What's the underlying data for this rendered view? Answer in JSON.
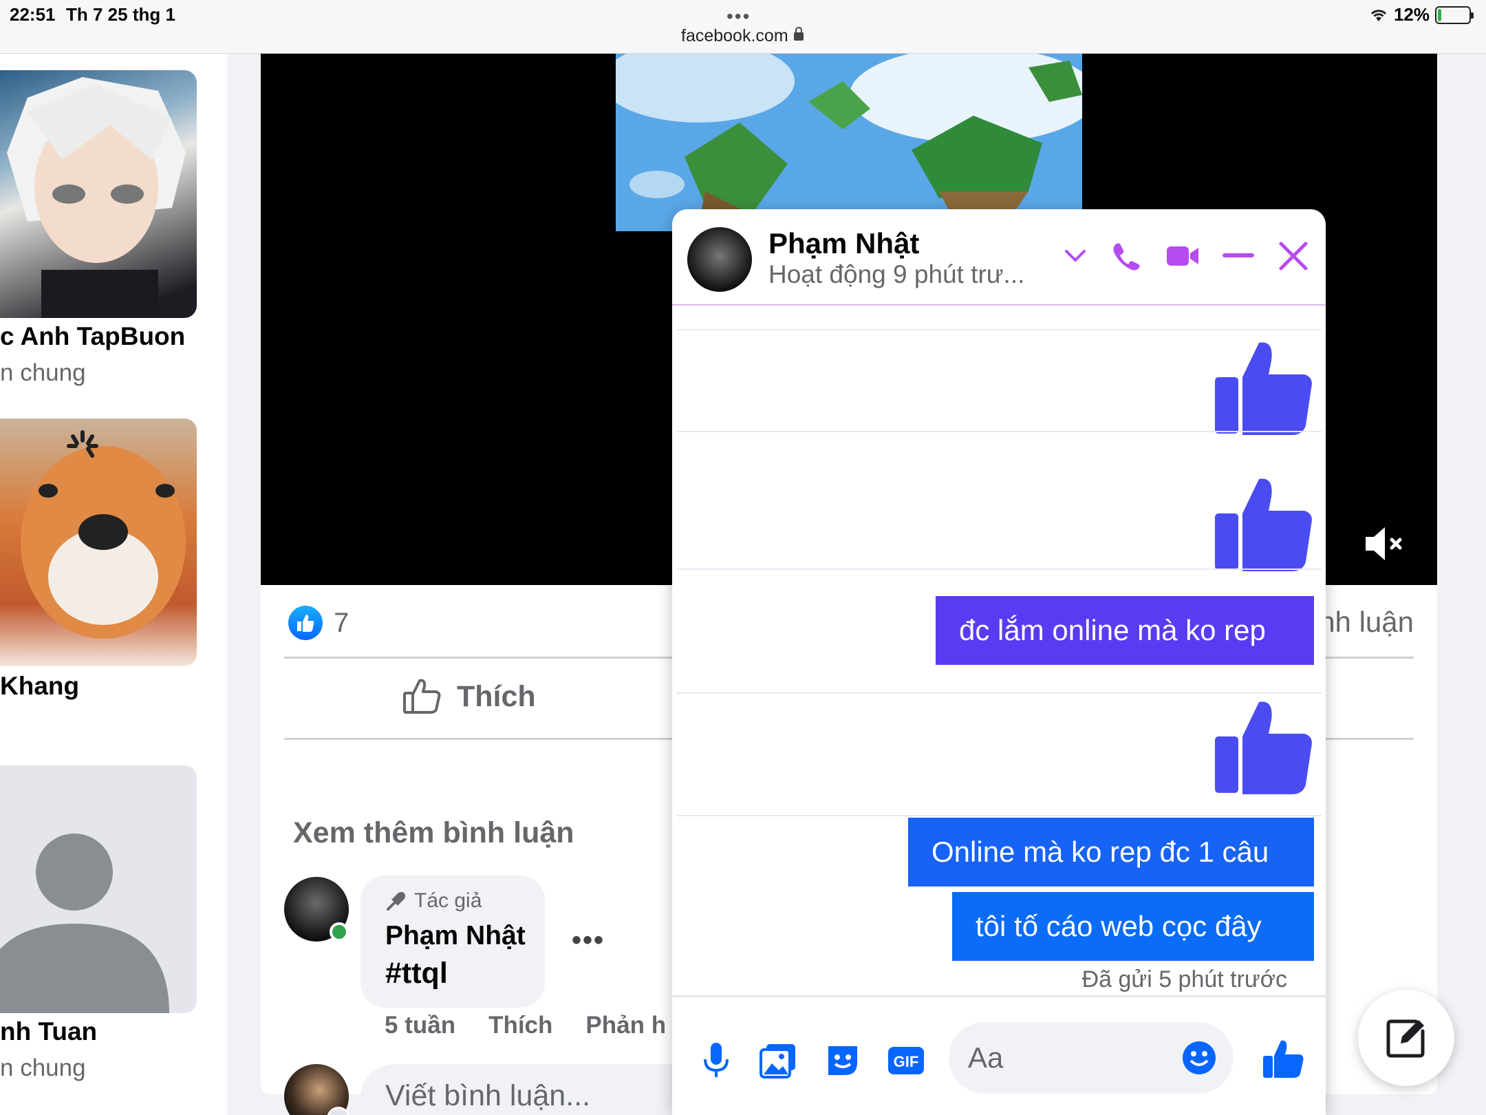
{
  "status_bar": {
    "time": "22:51",
    "date": "Th 7 25 thg 1",
    "url": "facebook.com",
    "battery": "12%",
    "battery_level": 0.12
  },
  "people": [
    {
      "name": "c Anh TapBuon",
      "sub": "n chung"
    },
    {
      "name": "Khang",
      "sub": ""
    },
    {
      "name": "nh Tuan",
      "sub": "n chung"
    }
  ],
  "post": {
    "reaction_count": "7",
    "comment_count": "nh luận",
    "like_label": "Thích",
    "more_comments": "Xem thêm bình luận",
    "comment": {
      "author_tag": "Tác giả",
      "author": "Phạm Nhật",
      "text": "#ttql",
      "more": "•••",
      "time": "5 tuần",
      "like": "Thích",
      "reply": "Phản h"
    },
    "write_placeholder": "Viết bình luận..."
  },
  "chat": {
    "name": "Phạm Nhật",
    "status": "Hoạt động 9 phút trư...",
    "messages": [
      {
        "type": "like"
      },
      {
        "type": "like"
      },
      {
        "type": "text",
        "text": "đc lắm online mà ko rep",
        "color": "#5b3bf2"
      },
      {
        "type": "like"
      },
      {
        "type": "text",
        "text": "Online mà ko rep đc 1 câu",
        "color": "#1663f5"
      },
      {
        "type": "text",
        "text": "tôi tố cáo web cọc đây",
        "color": "#0a6cf7"
      }
    ],
    "sent_meta": "Đã gửi 5 phút trước",
    "composer_placeholder": "Aa"
  },
  "colors": {
    "messenger_accent": "#b64bf2",
    "like_blue": "#4b4cf0",
    "fb_blue": "#0866ff"
  }
}
